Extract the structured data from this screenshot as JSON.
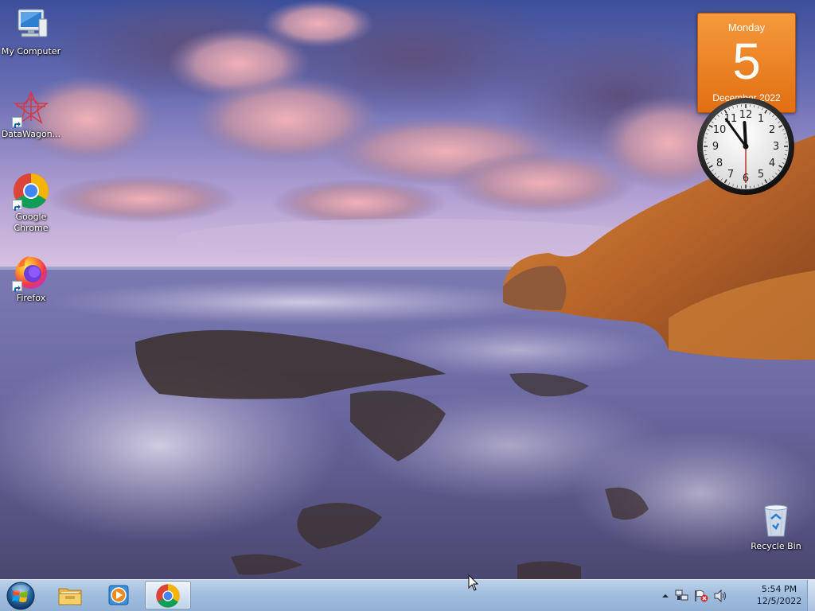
{
  "desktop": {
    "icons": [
      {
        "label": "My Computer",
        "icon": "computer-icon"
      },
      {
        "label": "DataWagon...",
        "icon": "datawagon-icon"
      },
      {
        "label": "Google Chrome",
        "icon": "chrome-icon"
      },
      {
        "label": "Firefox",
        "icon": "firefox-icon"
      },
      {
        "label": "Recycle Bin",
        "icon": "recycle-bin-icon"
      }
    ]
  },
  "gadgets": {
    "calendar": {
      "weekday": "Monday",
      "day": "5",
      "month_year": "December 2022",
      "color": "#e8781c"
    },
    "clock": {
      "hour": 11,
      "minute": 54,
      "second": 30
    }
  },
  "taskbar": {
    "start_icon": "windows-logo-icon",
    "pinned": [
      {
        "name": "windows-explorer",
        "icon": "folder-icon",
        "active": false
      },
      {
        "name": "media-player",
        "icon": "media-player-icon",
        "active": false
      },
      {
        "name": "google-chrome",
        "icon": "chrome-icon",
        "active": true
      }
    ],
    "tray_icons": [
      "show-hidden-icons-chevron",
      "network-icon",
      "action-center-flag-icon",
      "volume-icon"
    ],
    "clock": {
      "time": "5:54 PM",
      "date": "12/5/2022"
    }
  }
}
